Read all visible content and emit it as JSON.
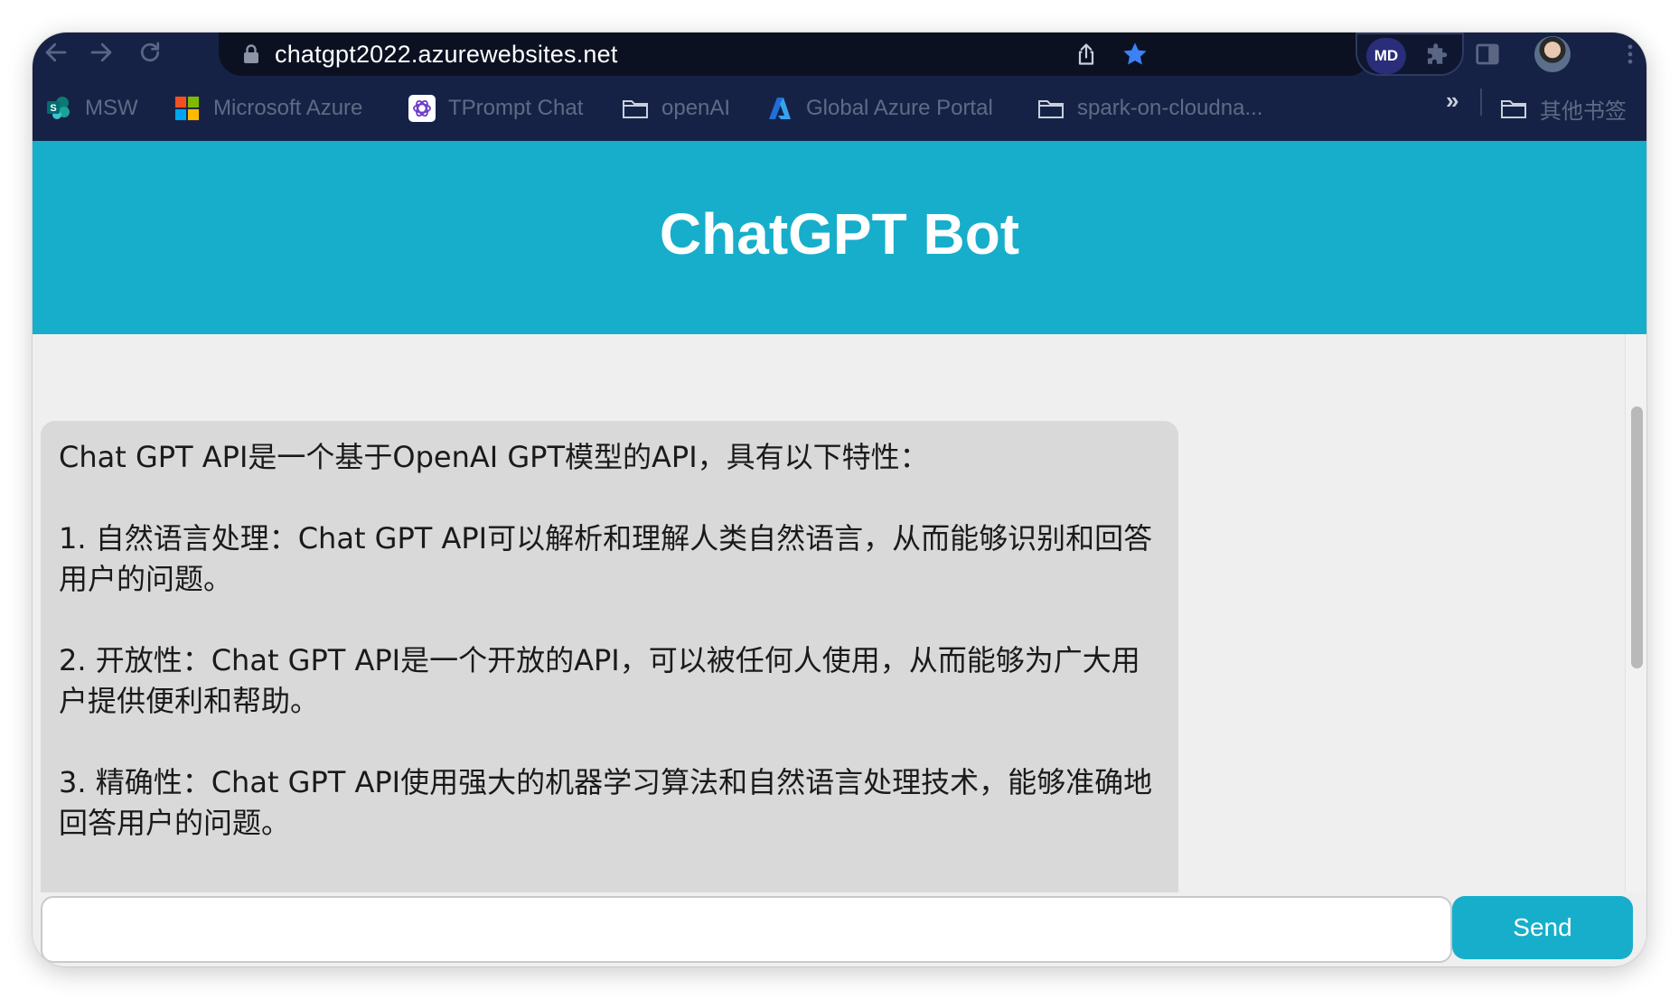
{
  "browser": {
    "url": "chatgpt2022.azurewebsites.net",
    "profile_badge": "MD",
    "bookmarks": [
      {
        "label": "MSW",
        "icon": "sharepoint-icon"
      },
      {
        "label": "Microsoft Azure",
        "icon": "microsoft-logo-icon"
      },
      {
        "label": "TPrompt Chat",
        "icon": "openai-logo-icon"
      },
      {
        "label": "openAI",
        "icon": "folder-icon"
      },
      {
        "label": "Global Azure Portal",
        "icon": "azure-logo-icon"
      },
      {
        "label": "spark-on-cloudna...",
        "icon": "folder-icon"
      }
    ],
    "overflow_chevron": "»",
    "other_bookmarks": "其他书签"
  },
  "app": {
    "title": "ChatGPT Bot",
    "accent_color": "#17aecb"
  },
  "messages": [
    {
      "role": "bot",
      "paragraphs": [
        "Chat GPT API是一个基于OpenAI GPT模型的API，具有以下特性：",
        "1. 自然语言处理：Chat GPT API可以解析和理解人类自然语言，从而能够识别和回答用户的问题。",
        "2. 开放性：Chat GPT API是一个开放的API，可以被任何人使用，从而能够为广大用户提供便利和帮助。",
        "3. 精确性：Chat GPT API使用强大的机器学习算法和自然语言处理技术，能够准确地回答用户的问题。"
      ]
    }
  ],
  "composer": {
    "value": "",
    "placeholder": "",
    "send_label": "Send"
  }
}
